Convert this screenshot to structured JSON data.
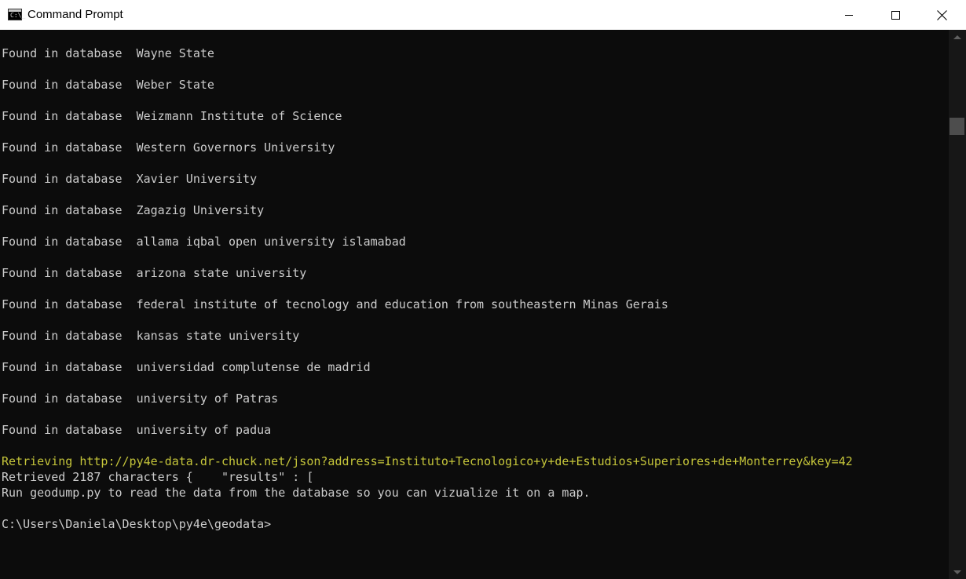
{
  "window": {
    "title": "Command Prompt",
    "icon": "cmd-icon",
    "icon_text": "C:\\_"
  },
  "console": {
    "found_lines": [
      "Found in database  Wayne State",
      "Found in database  Weber State",
      "Found in database  Weizmann Institute of Science",
      "Found in database  Western Governors University",
      "Found in database  Xavier University",
      "Found in database  Zagazig University",
      "Found in database  allama iqbal open university islamabad",
      "Found in database  arizona state university",
      "Found in database  federal institute of tecnology and education from southeastern Minas Gerais",
      "Found in database  kansas state university",
      "Found in database  universidad complutense de madrid",
      "Found in database  university of Patras",
      "Found in database  university of padua"
    ],
    "retrieving": "Retrieving http://py4e-data.dr-chuck.net/json?address=Instituto+Tecnologico+y+de+Estudios+Superiores+de+Monterrey&key=42",
    "retrieved": "Retrieved 2187 characters {    \"results\" : [",
    "run_msg": "Run geodump.py to read the data from the database so you can vizualize it on a map.",
    "prompt": "C:\\Users\\Daniela\\Desktop\\py4e\\geodata>"
  },
  "colors": {
    "background": "#0c0c0c",
    "text": "#cccccc",
    "highlight": "#c5c53a"
  },
  "scrollbar": {
    "position_fraction": 0.17
  }
}
